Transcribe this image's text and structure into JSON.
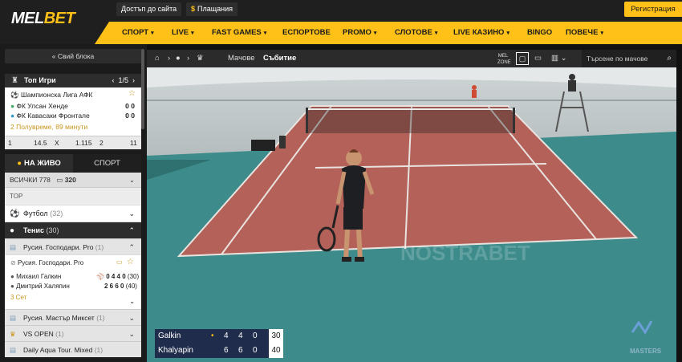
{
  "header": {
    "logo_main": "MEL",
    "logo_accent": "BET",
    "site_access": "Достъп до сайта",
    "payments_icon": "$",
    "payments": "Плащания",
    "register": "Регистрация"
  },
  "nav": {
    "items": [
      {
        "label": "СПОРТ",
        "caret": "▾"
      },
      {
        "label": "LIVE",
        "caret": "▾"
      },
      {
        "label": "FAST GAMES",
        "caret": "▾"
      },
      {
        "label": "ЕСПОРТОВЕ",
        "caret": ""
      },
      {
        "label": "PROMO",
        "caret": "▾"
      },
      {
        "label": "СЛОТОВЕ",
        "caret": "▾"
      },
      {
        "label": "LIVE КАЗИНО",
        "caret": "▾"
      },
      {
        "label": "BINGO",
        "caret": ""
      },
      {
        "label": "ПОВЕЧЕ",
        "caret": "▾"
      }
    ]
  },
  "sidebar": {
    "hide_blocks": "« Свий блока",
    "top_games": {
      "title": "Топ Игри",
      "page": "1/5",
      "prev": "‹",
      "next": "›",
      "league": "Шампионска Лига АФК",
      "team1": "ФК Улсан Хенде",
      "team1_score": "0 0",
      "team2": "ФК Кавасаки Фронтале",
      "team2_score": "0 0",
      "time": "2 Полувреме, 89 минути",
      "odds": [
        {
          "label": "1",
          "value": "14.5"
        },
        {
          "label": "X",
          "value": "1.115"
        },
        {
          "label": "2",
          "value": "11"
        }
      ]
    },
    "tabs": {
      "live": "НА ЖИВО",
      "sport": "СПОРТ"
    },
    "all_label": "ВСИЧКИ 778",
    "video_count": "320",
    "top_label": "TOP",
    "football": {
      "label": "Футбол",
      "count": "(32)"
    },
    "tennis": {
      "label": "Тенис",
      "count": "(30)"
    },
    "league1": {
      "label": "Русия. Господари. Pro",
      "count": "(1)"
    },
    "game": {
      "league": "Русия. Господари. Pro",
      "player1": "Михаил Галкин",
      "player1_score": "0 4 4 0",
      "player1_pts": "(30)",
      "player2": "Дмитрий Халяпин",
      "player2_score": "2 6 6 0",
      "player2_pts": "(40)",
      "set": "3 Сет"
    },
    "league2": {
      "label": "Русия. Мастър Миксет",
      "count": "(1)"
    },
    "league3": {
      "label": "VS OPEN",
      "count": "(1)"
    },
    "league4": {
      "label": "Daily Aqua Tour. Mixed",
      "count": "(1)"
    }
  },
  "toolbar": {
    "matches": "Мачове",
    "event": "Събитие",
    "search_placeholder": "Търсене по мачове",
    "zone_label": "MEL ZONE"
  },
  "video": {
    "watermark": "NOSTRABET",
    "brand": "MASTERS",
    "scoreboard": [
      {
        "name": "Galkin",
        "serve": "•",
        "s1": "4",
        "s2": "4",
        "s3": "0",
        "pts": "30"
      },
      {
        "name": "Khalyapin",
        "serve": "",
        "s1": "6",
        "s2": "6",
        "s3": "0",
        "pts": "40"
      }
    ]
  },
  "colors": {
    "accent": "#ffc117",
    "court_clay": "#b4615a",
    "court_green": "#3d8c8b",
    "scoreboard": "#1f2c4c"
  }
}
